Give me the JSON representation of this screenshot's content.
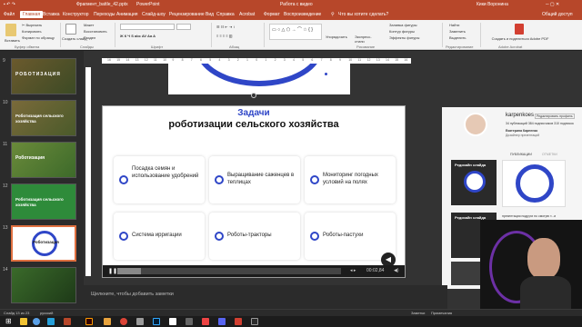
{
  "titlebar": {
    "filename": "Фрагмент_battle_42.pptx",
    "app": "PowerPoint",
    "status": "Работа с видео",
    "user": "Кики Воронина"
  },
  "menu": [
    "Файл",
    "Главная",
    "Вставка",
    "Конструктор",
    "Переходы",
    "Анимация",
    "Слайд-шоу",
    "Рецензирование",
    "Вид",
    "Справка",
    "Acrobat",
    "Формат",
    "Воспроизведение"
  ],
  "search_placeholder": "Что вы хотите сделать?",
  "share_label": "Общий доступ",
  "ribbon": {
    "clipboard": [
      "Вставить",
      "Копировать",
      "Формат по образцу"
    ],
    "slides": [
      "Создать слайд",
      "Макет",
      "Восстановить",
      "Раздел"
    ],
    "groups": [
      "Буфер обмена",
      "Слайды",
      "Шрифт",
      "Абзац",
      "Рисование",
      "Редактирование",
      "Adobe Acrobat"
    ],
    "drawing": [
      "Упорядочить",
      "Экспресс-стили",
      "Заливка фигуры",
      "Контур фигуры",
      "Эффекты фигуры"
    ],
    "editing": [
      "Найти",
      "Заменить",
      "Выделить"
    ],
    "acrobat": "Создать и поделиться Adobe PDF"
  },
  "slides": [
    {
      "num": "9",
      "title": "РОБОТИЗАЦИЯ"
    },
    {
      "num": "10",
      "title": "Роботизация сельского хозяйства"
    },
    {
      "num": "11",
      "title": "Роботизация"
    },
    {
      "num": "12",
      "title": "Роботизация сельского хозяйства"
    },
    {
      "num": "13",
      "title": "Роботизация"
    },
    {
      "num": "14",
      "title": ""
    }
  ],
  "ruler": [
    "16",
    "15",
    "14",
    "13",
    "12",
    "11",
    "10",
    "9",
    "8",
    "7",
    "6",
    "5",
    "4",
    "3",
    "2",
    "1",
    "0",
    "1",
    "2",
    "3",
    "4",
    "5",
    "6",
    "7",
    "8",
    "9",
    "10",
    "11",
    "12",
    "13",
    "14",
    "15",
    "16"
  ],
  "slide": {
    "title_accent": "Задачи",
    "title": "роботизации сельского хозяйства",
    "cards": [
      "Посадка семян и использование удобрений",
      "Выращивание саженцев в теплицах",
      "Мониторинг погодных условий на полях",
      "Система ирригации",
      "Роботы-тракторы",
      "Роботы-пастухи"
    ],
    "video_time": "00:02,84"
  },
  "web": {
    "account": "karpenkoes",
    "edit_label": "Редактировать профиль",
    "stats": "34 публикаций   384 подписчиков   310 подписок",
    "name": "Екатерина Карпенко",
    "role": "Дизайнер презентаций",
    "tab1": "ПУБЛИКАЦИИ",
    "tab2": "ОТМЕТКИ",
    "post_title": "Редизайн слайда",
    "caption1": "презентация подруги по смотрю т...и",
    "caption2": "Редизайн слайда"
  },
  "notes_placeholder": "Щелкните, чтобы добавить заметки",
  "status": {
    "slide": "Слайд 13 из 23",
    "lang": "русский",
    "notes": "Заметки",
    "comments": "Примечания",
    "zoom": "68%"
  },
  "colors": {
    "accent": "#b7472a",
    "brand_blue": "#2f46c7",
    "green": "#2e8b3a"
  }
}
